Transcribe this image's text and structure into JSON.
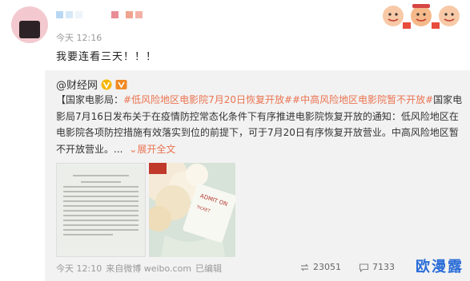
{
  "post": {
    "time": "今天 12:16",
    "text": "我要连看三天！！！"
  },
  "repost": {
    "author": "@财经网",
    "body_prefix": "【国家电影局：",
    "hashtag1": "#低风险地区电影院7月20日恢复开放#",
    "hashtag2": "#中高风险地区电影院暂不开放#",
    "body_suffix": "国家电影局7月16日发布关于在疫情防控常态化条件下有序推进电影院恢复开放的通知：低风险地区在电影院各项防控措施有效落实到位的前提下，可于7月20日有序恢复开放营业。中高风险地区暂不开放营业。",
    "ellipsis": "...",
    "expand_label": "展开全文",
    "time": "今天 12:10",
    "source": "来自微博 weibo.com",
    "edited": "已编辑",
    "repost_count": "23051",
    "comment_count": "7133"
  },
  "watermark": "欧漫露",
  "colors": {
    "link": "#eb7350",
    "verified": "#f7b500",
    "repost_bg": "#f2f2f2"
  }
}
